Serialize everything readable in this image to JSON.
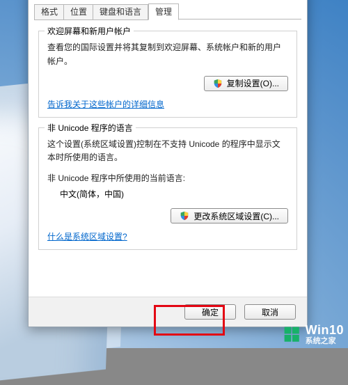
{
  "tabs": {
    "format": "格式",
    "location": "位置",
    "keyboard": "键盘和语言",
    "admin": "管理"
  },
  "group_welcome": {
    "legend": "欢迎屏幕和新用户帐户",
    "desc": "查看您的国际设置并将其复制到欢迎屏幕、系统帐户和新的用户帐户。",
    "copy_btn": "复制设置(O)...",
    "link": "告诉我关于这些帐户的详细信息"
  },
  "group_nonunicode": {
    "legend": "非 Unicode 程序的语言",
    "desc": "这个设置(系统区域设置)控制在不支持 Unicode 的程序中显示文本时所使用的语言。",
    "current_label": "非 Unicode 程序中所使用的当前语言:",
    "current_value": "中文(简体，中国)",
    "change_btn": "更改系统区域设置(C)...",
    "link": "什么是系统区域设置?"
  },
  "dialog_buttons": {
    "ok": "确定",
    "cancel": "取消"
  },
  "watermark": {
    "brand": "Win10",
    "site": "系统之家"
  }
}
